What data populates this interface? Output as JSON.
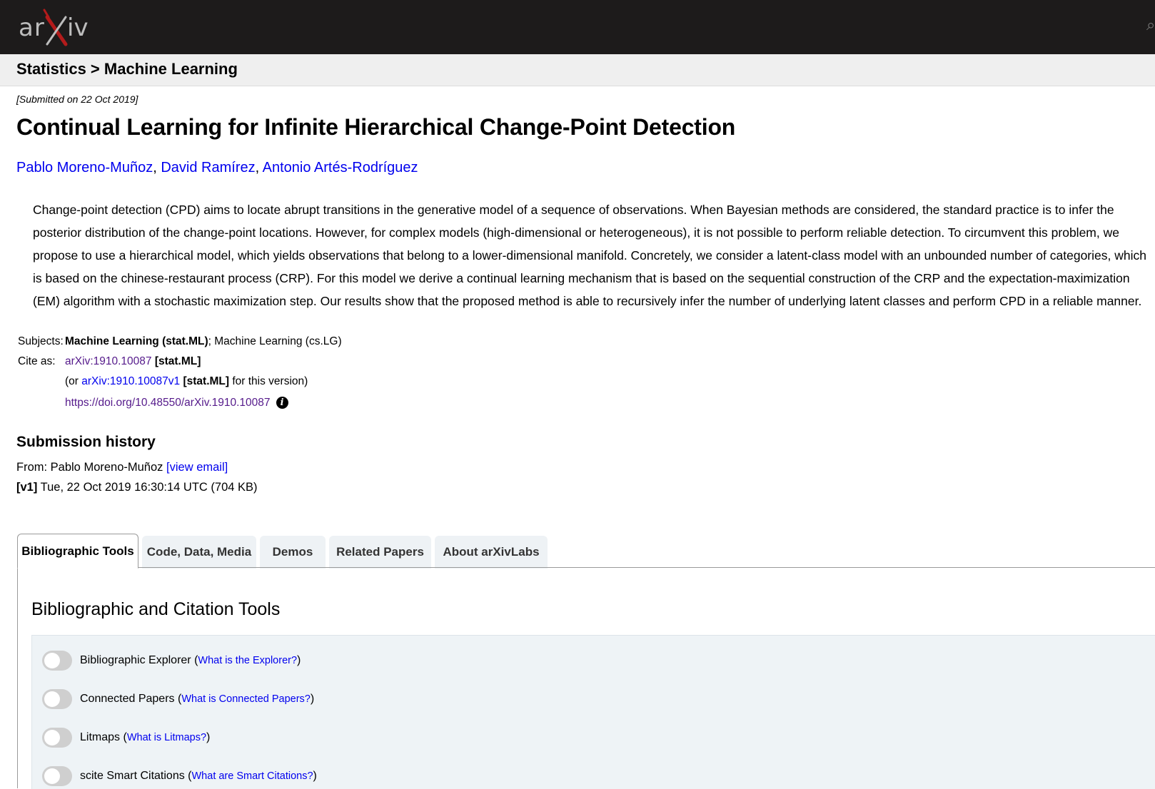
{
  "header": {
    "logo_text": "arXiv",
    "brand_color": "#b31b1b",
    "background": "#1d1b1b"
  },
  "breadcrumb": {
    "text": "Statistics > Machine Learning"
  },
  "paper": {
    "submitted": "[Submitted on 22 Oct 2019]",
    "title": "Continual Learning for Infinite Hierarchical Change-Point Detection",
    "authors": [
      "Pablo Moreno-Muñoz",
      "David Ramírez",
      "Antonio Artés-Rodríguez"
    ],
    "author_separator": ",",
    "abstract": "Change-point detection (CPD) aims to locate abrupt transitions in the generative model of a sequence of observations. When Bayesian methods are considered, the standard practice is to infer the posterior distribution of the change-point locations. However, for complex models (high-dimensional or heterogeneous), it is not possible to perform reliable detection. To circumvent this problem, we propose to use a hierarchical model, which yields observations that belong to a lower-dimensional manifold. Concretely, we consider a latent-class model with an unbounded number of categories, which is based on the chinese-restaurant process (CRP). For this model we derive a continual learning mechanism that is based on the sequential construction of the CRP and the expectation-maximization (EM) algorithm with a stochastic maximization step. Our results show that the proposed method is able to recursively infer the number of underlying latent classes and perform CPD in a reliable manner."
  },
  "metadata": {
    "subjects_label": "Subjects:",
    "subjects_primary": "Machine Learning (stat.ML)",
    "subjects_rest": "; Machine Learning (cs.LG)",
    "cite_label": "Cite as:",
    "cite_id": "arXiv:1910.10087",
    "cite_tag": "[stat.ML]",
    "version_prefix": "(or",
    "version_id": "arXiv:1910.10087v1",
    "version_tag": "[stat.ML]",
    "version_suffix": "for this version)",
    "doi": "https://doi.org/10.48550/arXiv.1910.10087",
    "info_glyph": "i"
  },
  "history": {
    "title": "Submission history",
    "from_prefix": "From: Pablo Moreno-Muñoz",
    "view_email": "[view email]",
    "v1_label": "[v1]",
    "v1_text": "Tue, 22 Oct 2019 16:30:14 UTC (704 KB)"
  },
  "tabs": [
    {
      "label": "Bibliographic Tools",
      "active": true
    },
    {
      "label": "Code, Data, Media",
      "active": false
    },
    {
      "label": "Demos",
      "active": false
    },
    {
      "label": "Related Papers",
      "active": false
    },
    {
      "label": "About arXivLabs",
      "active": false
    }
  ],
  "tools_panel": {
    "title": "Bibliographic and Citation Tools",
    "tools": [
      {
        "name": "Bibliographic Explorer",
        "help": "What is the Explorer?",
        "enabled": false
      },
      {
        "name": "Connected Papers",
        "help": "What is Connected Papers?",
        "enabled": false
      },
      {
        "name": "Litmaps",
        "help": "What is Litmaps?",
        "enabled": false
      },
      {
        "name": "scite Smart Citations",
        "help": "What are Smart Citations?",
        "enabled": false
      }
    ]
  }
}
